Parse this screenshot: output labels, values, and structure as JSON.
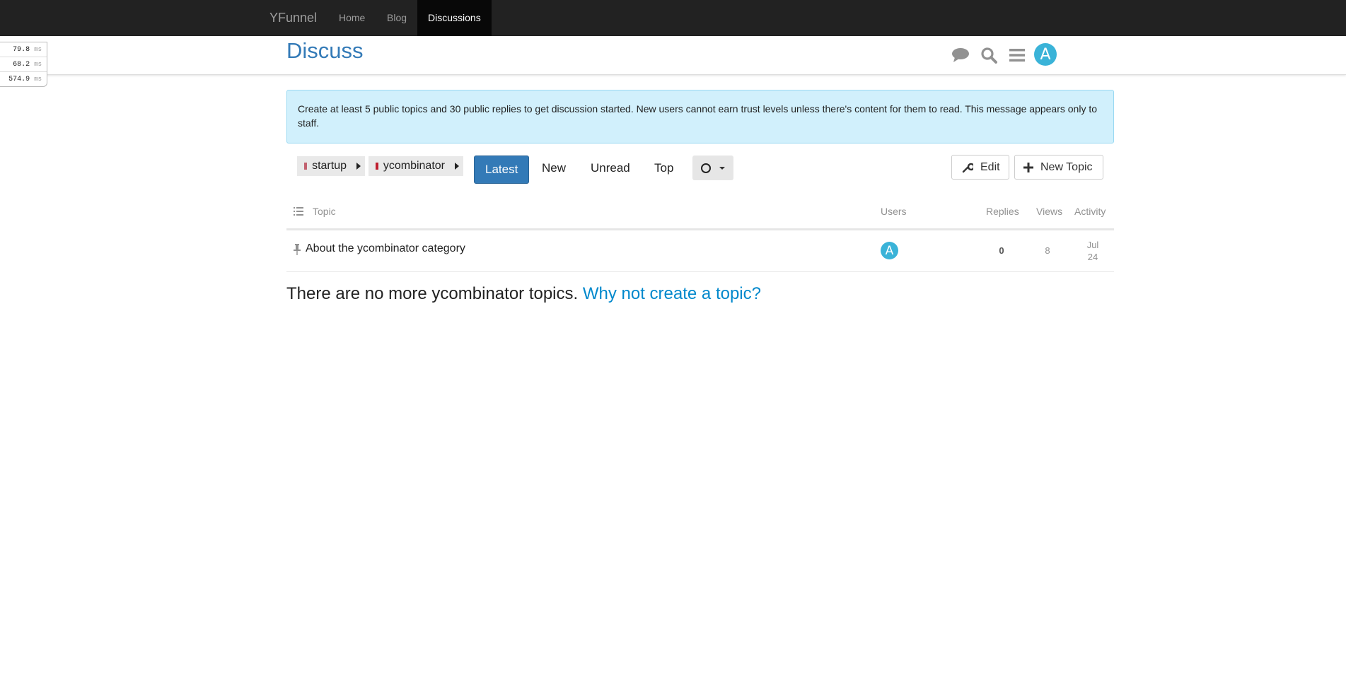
{
  "topnav": {
    "brand": "YFunnel",
    "links": [
      {
        "label": "Home"
      },
      {
        "label": "Blog"
      },
      {
        "label": "Discussions",
        "active": true
      }
    ]
  },
  "header": {
    "title": "Discuss",
    "icons": [
      "chat-icon",
      "search-icon",
      "hamburger-menu-icon"
    ],
    "avatar_letter": "A"
  },
  "profiler": [
    {
      "value": "79.8",
      "unit": "ms"
    },
    {
      "value": "68.2",
      "unit": "ms"
    },
    {
      "value": "574.9",
      "unit": "ms"
    }
  ],
  "alert": {
    "text": "Create at least 5 public topics and 30 public replies to get discussion started. New users cannot earn trust levels unless there's content for them to read. This message appears only to staff."
  },
  "nav": {
    "breadcrumbs": [
      {
        "label": "startup",
        "color": "#c2616f"
      },
      {
        "label": "ycombinator",
        "color": "#bf1e2e"
      }
    ],
    "pills": [
      {
        "label": "Latest",
        "active": true
      },
      {
        "label": "New"
      },
      {
        "label": "Unread"
      },
      {
        "label": "Top"
      }
    ],
    "notification_icon": "circle-icon",
    "edit_label": "Edit",
    "new_topic_label": "New Topic"
  },
  "table": {
    "headers": {
      "topic": "Topic",
      "users": "Users",
      "replies": "Replies",
      "views": "Views",
      "activity": "Activity"
    },
    "rows": [
      {
        "title": "About the ycombinator category",
        "pinned": true,
        "user_letter": "A",
        "replies": "0",
        "views": "8",
        "activity_month": "Jul",
        "activity_day": "24"
      }
    ]
  },
  "footer": {
    "text": "There are no more ycombinator topics.",
    "link": "Why not create a topic?"
  },
  "colors": {
    "accent": "#337ab7",
    "avatar": "#3ab3d8",
    "alert_bg": "#d1f0fc",
    "nav_bg": "#222222"
  }
}
